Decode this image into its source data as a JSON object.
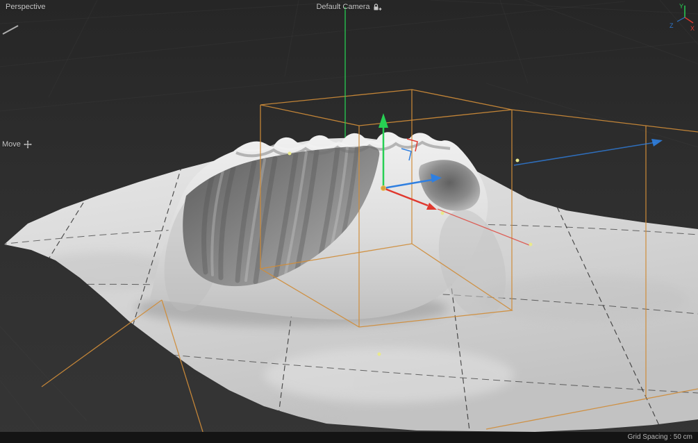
{
  "viewport": {
    "view_label": "Perspective",
    "camera_label": "Default Camera",
    "tool_label": "Move",
    "grid_spacing_label": "Grid Spacing : 50 cm"
  },
  "axis_hud": {
    "x": "X",
    "y": "Y",
    "z": "Z"
  },
  "colors": {
    "background": "#303030",
    "background_top": "#262626",
    "panel_dark": "#141414",
    "label_text": "#c8c8c8",
    "selection_orange": "#cf8c38",
    "axis_x_red": "#e0382e",
    "axis_y_green": "#27cf53",
    "axis_z_blue": "#2f7fe0",
    "terrain_light": "#d9d9d9",
    "grid_line_dark": "#1e1e1e",
    "point_yellow": "#e9e98c"
  }
}
